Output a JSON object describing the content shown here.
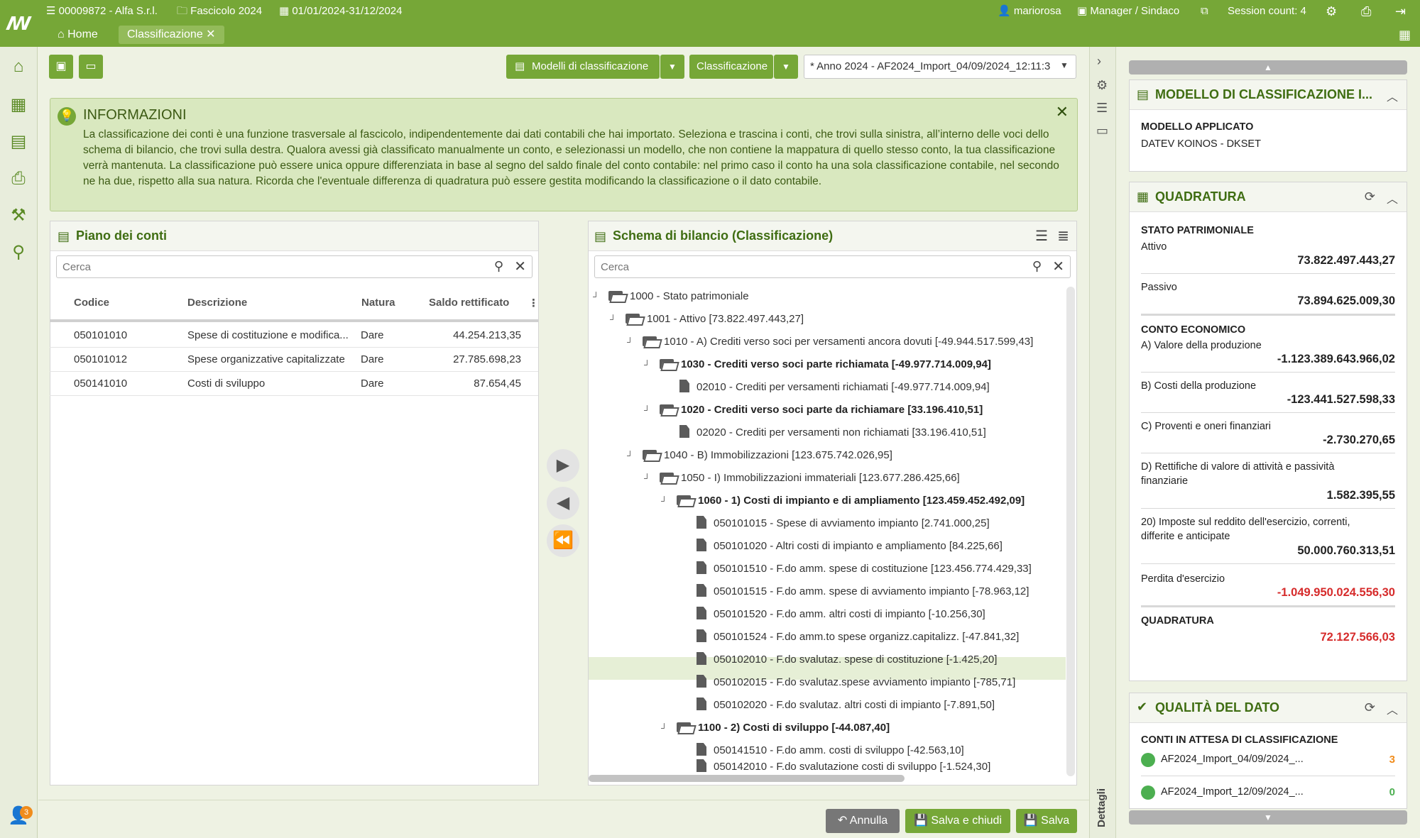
{
  "topbar": {
    "company": "00009872 - Alfa S.r.l.",
    "fascicolo": "Fascicolo 2024",
    "period": "01/01/2024-31/12/2024",
    "user": "mariorosa",
    "role": "Manager / Sindaco",
    "session": "Session count: 4"
  },
  "tabs": {
    "home": "Home",
    "active": "Classificazione"
  },
  "toolbar": {
    "modelli": "Modelli di classificazione",
    "classificazione": "Classificazione",
    "anno": "* Anno 2024 - AF2024_Import_04/09/2024_12:11:3"
  },
  "info": {
    "title": "INFORMAZIONI",
    "text": "La classificazione dei conti è una funzione trasversale al fascicolo, indipendentemente dai dati contabili che hai importato. Seleziona e trascina i conti, che trovi sulla sinistra, all’interno delle voci dello schema di bilancio, che trovi sulla destra. Qualora avessi già classificato manualmente un conto, e selezionassi un modello, che non contiene la mappatura di quello stesso conto, la tua classificazione verrà mantenuta. La classificazione può essere unica oppure differenziata in base al segno del saldo finale del conto contabile: nel primo caso il conto ha una sola classificazione contabile, nel secondo ne ha due, rispetto alla sua natura. Ricorda che l'eventuale differenza di quadratura può essere gestita modificando la classificazione o il dato contabile."
  },
  "piano": {
    "title": "Piano dei conti",
    "search_placeholder": "Cerca",
    "columns": {
      "codice": "Codice",
      "descrizione": "Descrizione",
      "natura": "Natura",
      "saldo": "Saldo rettificato"
    },
    "rows": [
      {
        "codice": "050101010",
        "descrizione": "Spese di costituzione e modifica...",
        "natura": "Dare",
        "saldo": "44.254.213,35"
      },
      {
        "codice": "050101012",
        "descrizione": "Spese organizzative capitalizzate",
        "natura": "Dare",
        "saldo": "27.785.698,23"
      },
      {
        "codice": "050141010",
        "descrizione": "Costi di sviluppo",
        "natura": "Dare",
        "saldo": "87.654,45"
      }
    ]
  },
  "schema": {
    "title": "Schema di bilancio (Classificazione)",
    "search_placeholder": "Cerca",
    "nodes": [
      "1000 - Stato patrimoniale",
      "1001 - Attivo   [73.822.497.443,27]",
      "1010 - A) Crediti verso soci per versamenti ancora dovuti   [-49.944.517.599,43]",
      "1030 - Crediti verso soci parte richiamata   [-49.977.714.009,94]",
      "02010 - Crediti per versamenti richiamati   [-49.977.714.009,94]",
      "1020 - Crediti verso soci parte da richiamare   [33.196.410,51]",
      "02020 - Crediti per versamenti non richiamati   [33.196.410,51]",
      "1040 - B) Immobilizzazioni   [123.675.742.026,95]",
      "1050 - I) Immobilizzazioni immateriali   [123.677.286.425,66]",
      "1060 - 1) Costi di impianto e di ampliamento   [123.459.452.492,09]",
      "050101015 - Spese di avviamento impianto   [2.741.000,25]",
      "050101020 - Altri costi di impianto e ampliamento   [84.225,66]",
      "050101510 - F.do amm. spese di costituzione   [123.456.774.429,33]",
      "050101515 - F.do amm. spese di avviamento impianto   [-78.963,12]",
      "050101520 - F.do amm. altri costi di impianto   [-10.256,30]",
      "050101524 - F.do amm.to spese organizz.capitalizz.   [-47.841,32]",
      "050102010 - F.do svalutaz. spese di costituzione   [-1.425,20]",
      "050102015 - F.do svalutaz.spese avviamento impianto   [-785,71]",
      "050102020 - F.do svalutaz. altri costi di impianto   [-7.891,50]",
      "1100 - 2) Costi di sviluppo   [-44.087,40]",
      "050141510 - F.do amm. costi di sviluppo   [-42.563,10]",
      "050142010 - F.do svalutazione costi di sviluppo   [-1.524,30]"
    ]
  },
  "modello": {
    "title": "MODELLO DI CLASSIFICAZIONE I...",
    "label": "MODELLO APPLICATO",
    "value": "DATEV KOINOS - DKSET"
  },
  "quadratura": {
    "title": "QUADRATURA",
    "sp_label": "STATO PATRIMONIALE",
    "attivo_label": "Attivo",
    "attivo": "73.822.497.443,27",
    "passivo_label": "Passivo",
    "passivo": "73.894.625.009,30",
    "ce_label": "CONTO ECONOMICO",
    "a_label": "A) Valore della produzione",
    "a": "-1.123.389.643.966,02",
    "b_label": "B) Costi della produzione",
    "b": "-123.441.527.598,33",
    "c_label": "C) Proventi e oneri finanziari",
    "c": "-2.730.270,65",
    "d_label1": "D) Rettifiche di valore di attività e passività",
    "d_label2": "finanziarie",
    "d": "1.582.395,55",
    "i_label1": "20) Imposte sul reddito dell'esercizio, correnti,",
    "i_label2": "differite e anticipate",
    "i": "50.000.760.313,51",
    "perdita_label": "Perdita d'esercizio",
    "perdita": "-1.049.950.024.556,30",
    "q_label": "QUADRATURA",
    "q": "72.127.566,03"
  },
  "qualita": {
    "title": "QUALITÀ DEL DATO",
    "label": "CONTI IN ATTESA DI CLASSIFICAZIONE",
    "items": [
      {
        "name": "AF2024_Import_04/09/2024_...",
        "count": "3"
      },
      {
        "name": "AF2024_Import_12/09/2024_...",
        "count": "0"
      }
    ]
  },
  "side": {
    "dettagli": "Dettagli"
  },
  "footer": {
    "annulla": "Annulla",
    "salva_chiudi": "Salva e chiudi",
    "salva": "Salva"
  },
  "notification_count": "3",
  "colors": {
    "green": "#76a737",
    "dark_green": "#3f6d12",
    "red": "#d62b2b",
    "orange": "#f08c1c"
  }
}
